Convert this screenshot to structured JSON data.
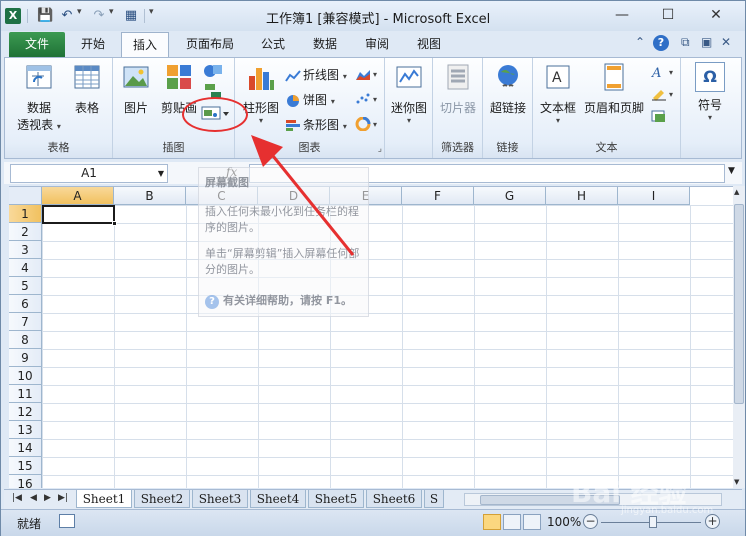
{
  "titlebar": {
    "title": "工作簿1  [兼容模式] - Microsoft Excel",
    "logo": "X",
    "minimize": "—",
    "maximize": "☐",
    "close": "✕"
  },
  "tabs": {
    "file": "文件",
    "items": [
      "开始",
      "插入",
      "页面布局",
      "公式",
      "数据",
      "审阅",
      "视图"
    ],
    "active": "插入"
  },
  "ribbon": {
    "groups": {
      "tables": {
        "label": "表格",
        "pivot": "数据\n透视表",
        "pivot_line1": "数据",
        "pivot_line2": "透视表",
        "table": "表格"
      },
      "illustrations": {
        "label": "插图",
        "picture": "图片",
        "clipart": "剪贴画"
      },
      "charts": {
        "label": "图表",
        "column": "柱形图",
        "line": "折线图",
        "pie": "饼图",
        "bar": "条形图"
      },
      "sparklines": {
        "label": "迷你图",
        "sparkline": "迷你图"
      },
      "filter": {
        "label": "筛选器",
        "slicer": "切片器"
      },
      "links": {
        "label": "链接",
        "hyperlink": "超链接"
      },
      "text": {
        "label": "文本",
        "textbox": "文本框",
        "headerfooter": "页眉和页脚"
      },
      "symbols": {
        "label": "符号",
        "symbol": "符号",
        "omega": "Ω"
      }
    }
  },
  "formula_bar": {
    "name_box": "A1",
    "fx": "fx",
    "value": ""
  },
  "grid": {
    "columns": [
      "A",
      "B",
      "C",
      "D",
      "E",
      "F",
      "G",
      "H",
      "I"
    ],
    "rows": [
      "1",
      "2",
      "3",
      "4",
      "5",
      "6",
      "7",
      "8",
      "9",
      "10",
      "11",
      "12",
      "13",
      "14",
      "15",
      "16"
    ],
    "active_cell": "A1"
  },
  "tooltip": {
    "title": "屏幕截图",
    "body1": "插入任何未最小化到任务栏的程序的图片。",
    "body2": "单击“屏幕剪辑”插入屏幕任何部分的图片。",
    "help": "有关详细帮助，请按 F1。"
  },
  "sheets": {
    "tabs": [
      "Sheet1",
      "Sheet2",
      "Sheet3",
      "Sheet4",
      "Sheet5",
      "Sheet6",
      "S"
    ],
    "active": "Sheet1"
  },
  "statusbar": {
    "status": "就绪",
    "zoom": "100%"
  },
  "watermark": {
    "text": "Bai 经验",
    "url": "jingyan.baidu.com"
  },
  "colors": {
    "file_tab": "#1f7236",
    "annotation": "#e63030",
    "selection": "#f1c15f"
  }
}
